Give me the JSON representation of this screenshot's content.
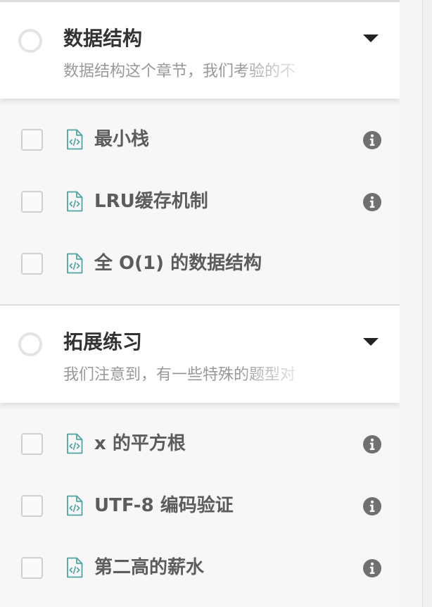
{
  "sections": [
    {
      "title": "数据结构",
      "description": "数据结构这个章节，我们考验的不",
      "items": [
        {
          "label": "最小栈",
          "has_info": true
        },
        {
          "label": "LRU缓存机制",
          "has_info": true
        },
        {
          "label": "全 O(1) 的数据结构",
          "has_info": false
        }
      ]
    },
    {
      "title": "拓展练习",
      "description": "我们注意到，有一些特殊的题型对",
      "items": [
        {
          "label": "x 的平方根",
          "has_info": true
        },
        {
          "label": "UTF-8 编码验证",
          "has_info": true
        },
        {
          "label": "第二高的薪水",
          "has_info": true
        }
      ]
    }
  ],
  "icons": {
    "section_status": "circle-outline-icon",
    "expand": "caret-down-icon",
    "item_type": "code-file-icon",
    "item_status": "checkbox",
    "info": "info-icon"
  },
  "colors": {
    "file_icon": "#4fa3a0",
    "info_icon": "#707070",
    "title": "#333333",
    "description": "#999999",
    "item_label": "#5c5c5c"
  }
}
